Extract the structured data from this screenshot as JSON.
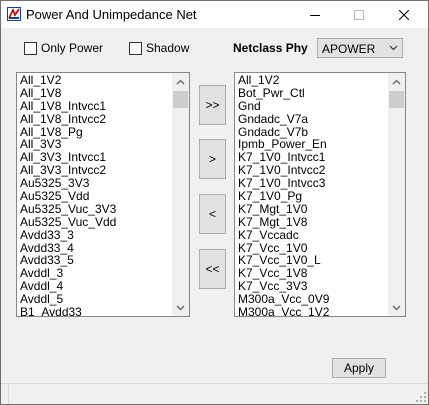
{
  "window": {
    "title": "Power And Unimpedance Net"
  },
  "options": {
    "only_power_label": "Only Power",
    "only_power_checked": false,
    "shadow_label": "Shadow",
    "shadow_checked": false
  },
  "netclass": {
    "label": "Netclass Phy",
    "selected": "APOWER"
  },
  "left_list": {
    "items": [
      "All_1V2",
      "All_1V8",
      "All_1V8_Intvcc1",
      "All_1V8_Intvcc2",
      "All_1V8_Pg",
      "All_3V3",
      "All_3V3_Intvcc1",
      "All_3V3_Intvcc2",
      "Au5325_3V3",
      "Au5325_Vdd",
      "Au5325_Vuc_3V3",
      "Au5325_Vuc_Vdd",
      "Avdd33_3",
      "Avdd33_4",
      "Avdd33_5",
      "Avddl_3",
      "Avddl_4",
      "Avddl_5",
      "B1_Avdd33"
    ]
  },
  "right_list": {
    "items": [
      "All_1V2",
      "Bot_Pwr_Ctl",
      "Gnd",
      "Gndadc_V7a",
      "Gndadc_V7b",
      "Ipmb_Power_En",
      "K7_1V0_Intvcc1",
      "K7_1V0_Intvcc2",
      "K7_1V0_Intvcc3",
      "K7_1V0_Pg",
      "K7_Mgt_1V0",
      "K7_Mgt_1V8",
      "K7_Vccadc",
      "K7_Vcc_1V0",
      "K7_Vcc_1V0_L",
      "K7_Vcc_1V8",
      "K7_Vcc_3V3",
      "M300a_Vcc_0V9",
      "M300a_Vcc_1V2"
    ]
  },
  "move_buttons": {
    "add_all": ">>",
    "add": ">",
    "remove": "<",
    "remove_all": "<<"
  },
  "apply_label": "Apply"
}
